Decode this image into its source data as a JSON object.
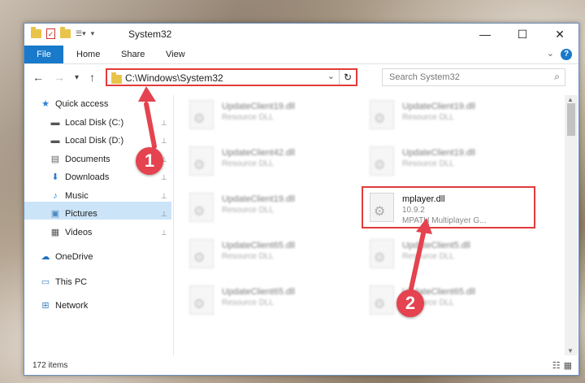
{
  "window": {
    "title": "System32",
    "controls": {
      "minimize": "—",
      "maximize": "☐",
      "close": "✕"
    }
  },
  "ribbon": {
    "tabs": [
      "File",
      "Home",
      "Share",
      "View"
    ],
    "help": "?"
  },
  "address": {
    "path": "C:\\Windows\\System32",
    "refresh": "↻",
    "search_placeholder": "Search System32"
  },
  "nav": {
    "back": "←",
    "forward": "→",
    "recent": "▾",
    "up": "↑"
  },
  "sidebar": {
    "items": [
      {
        "label": "Quick access",
        "icon": "star-icon",
        "glyph": "★",
        "color": "#2a7fd4",
        "pinned": false
      },
      {
        "label": "Local Disk (C:)",
        "icon": "drive-icon",
        "glyph": "▬",
        "color": "#555555",
        "pinned": true
      },
      {
        "label": "Local Disk (D:)",
        "icon": "drive-icon",
        "glyph": "▬",
        "color": "#555555",
        "pinned": true
      },
      {
        "label": "Documents",
        "icon": "document-icon",
        "glyph": "▤",
        "color": "#666666",
        "pinned": true
      },
      {
        "label": "Downloads",
        "icon": "download-icon",
        "glyph": "⬇",
        "color": "#2a7fd4",
        "pinned": true
      },
      {
        "label": "Music",
        "icon": "music-icon",
        "glyph": "♪",
        "color": "#2a7fd4",
        "pinned": true
      },
      {
        "label": "Pictures",
        "icon": "pictures-icon",
        "glyph": "▣",
        "color": "#4a8ac0",
        "pinned": true
      },
      {
        "label": "Videos",
        "icon": "video-icon",
        "glyph": "▦",
        "color": "#555555",
        "pinned": true
      },
      {
        "label": "OneDrive",
        "icon": "cloud-icon",
        "glyph": "☁",
        "color": "#1f6fc0",
        "pinned": false
      },
      {
        "label": "This PC",
        "icon": "computer-icon",
        "glyph": "▭",
        "color": "#3b7fc4",
        "pinned": false
      },
      {
        "label": "Network",
        "icon": "network-icon",
        "glyph": "⊞",
        "color": "#3b7fc4",
        "pinned": false
      }
    ],
    "selected": "This PC",
    "pin_glyph": "📌"
  },
  "files": [
    {
      "name": "UpdateClient19.dll",
      "desc": "Resource DLL"
    },
    {
      "name": "UpdateClient19.dll",
      "desc": "Resource DLL"
    },
    {
      "name": "UpdateClient42.dll",
      "desc": "Resource DLL"
    },
    {
      "name": "UpdateClient19.dll",
      "desc": "Resource DLL"
    },
    {
      "name": "UpdateClient19.dll",
      "desc": "Resource DLL"
    },
    {
      "name": "mplayer.dll",
      "version": "10.9.2",
      "desc": "MPATH Multiplayer G..."
    },
    {
      "name": "UpdateClient65.dll",
      "desc": "Resource DLL"
    },
    {
      "name": "UpdateClient5.dll",
      "desc": "Resource DLL"
    },
    {
      "name": "UpdateClient65.dll",
      "desc": "Resource DLL"
    },
    {
      "name": "UpdateClient65.dll",
      "desc": "Resource DLL"
    }
  ],
  "status": {
    "item_count": "172 items"
  },
  "annotations": {
    "step1": "1",
    "step2": "2",
    "color": "#e4434f"
  }
}
